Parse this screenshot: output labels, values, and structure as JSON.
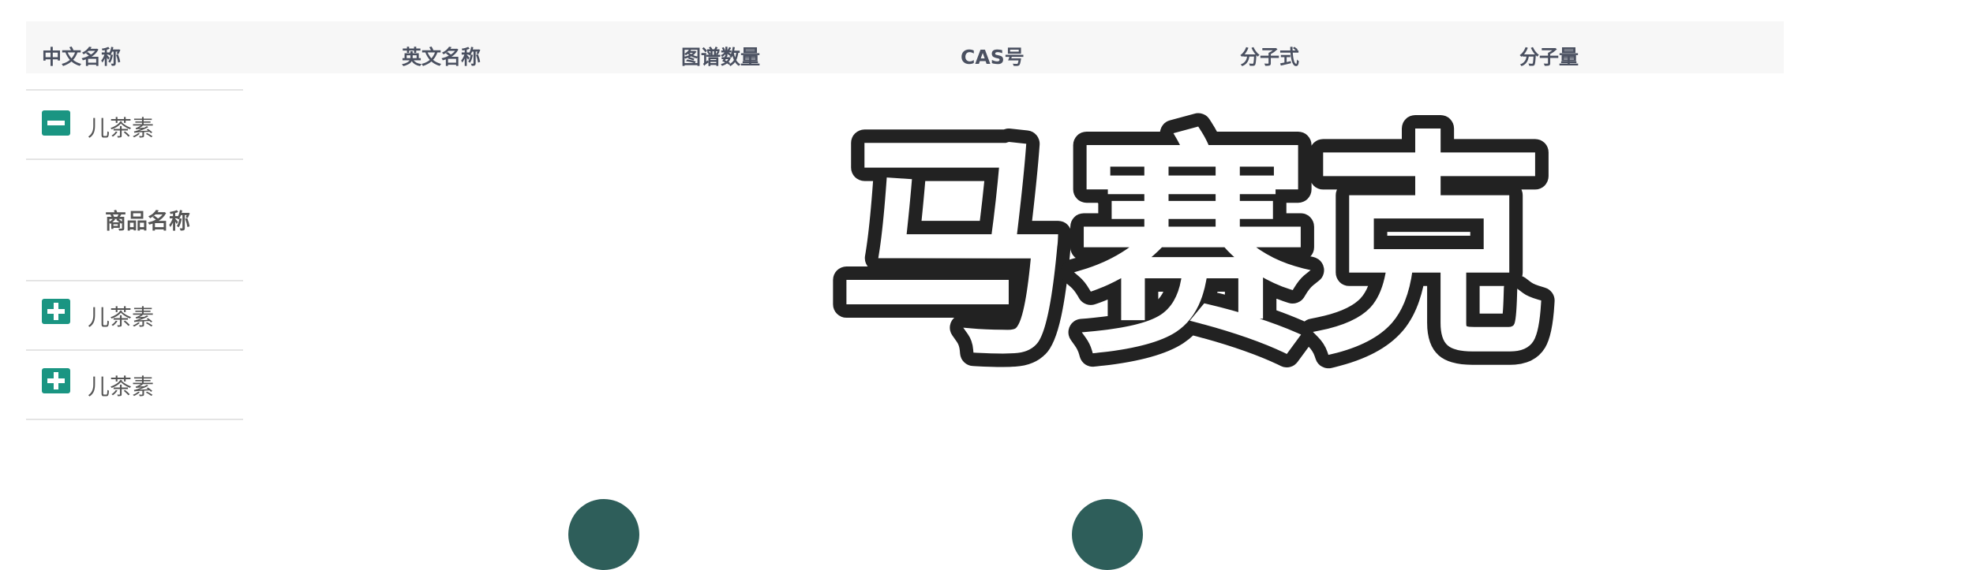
{
  "table": {
    "headers": [
      "中文名称",
      "英文名称",
      "图谱数量",
      "CAS号",
      "分子式",
      "分子量"
    ],
    "rows": [
      {
        "toggle": "collapse",
        "name": "儿茶素"
      },
      {
        "subheader": "商品名称"
      },
      {
        "toggle": "expand",
        "name": "儿茶素"
      },
      {
        "toggle": "expand",
        "name": "儿茶素"
      }
    ]
  },
  "watermark": {
    "text": "马赛克"
  },
  "colors": {
    "accent": "#1a9582",
    "header_bg": "#f7f7f7",
    "watermark_fill": "#ffffff",
    "watermark_stroke": "#222222"
  },
  "icons": {
    "collapse": "minus-square-icon",
    "expand": "plus-square-icon"
  }
}
